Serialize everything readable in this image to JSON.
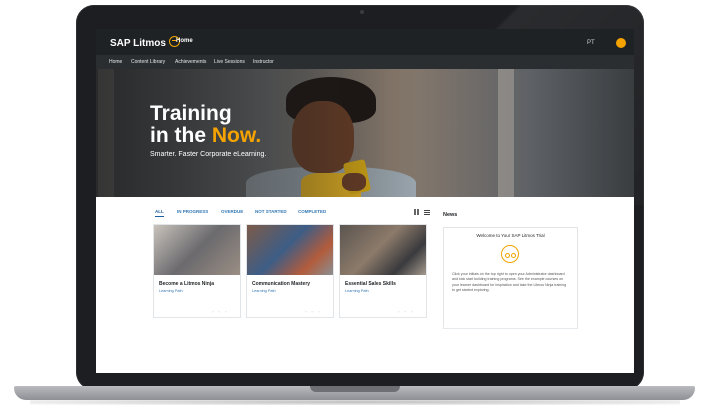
{
  "app": {
    "brand": "SAP Litmos",
    "page": "Home",
    "language": "PT",
    "accent_color": "#f5a300",
    "icons": [
      "logo-badge-icon",
      "user-avatar-icon",
      "grid-view-icon",
      "list-view-icon",
      "news-glasses-icon"
    ]
  },
  "nav": {
    "items": [
      "Home",
      "Content Library",
      "Achievements",
      "Live Sessions",
      "Instructor"
    ]
  },
  "hero": {
    "title_line1": "Training",
    "title_line2_prefix": "in the ",
    "title_line2_accent": "Now.",
    "subtitle": "Smarter. Faster Corporate eLearning."
  },
  "filters": {
    "tabs": [
      "ALL",
      "IN PROGRESS",
      "OVERDUE",
      "NOT STARTED",
      "COMPLETED"
    ],
    "active": "ALL"
  },
  "courses": [
    {
      "title": "Become a Litmos Ninja",
      "type": "Learning Path"
    },
    {
      "title": "Communication Mastery",
      "type": "Learning Path"
    },
    {
      "title": "Essential Sales Skills",
      "type": "Learning Path"
    }
  ],
  "news": {
    "heading": "News",
    "card_title": "Welcome to Your SAP Litmos Trial",
    "body": "Click your initials on the top right to open your Administrator dashboard and kick start building training programs. See the example courses on your learner dashboard for inspiration and take the Litmos Ninja training to get started exploring."
  }
}
